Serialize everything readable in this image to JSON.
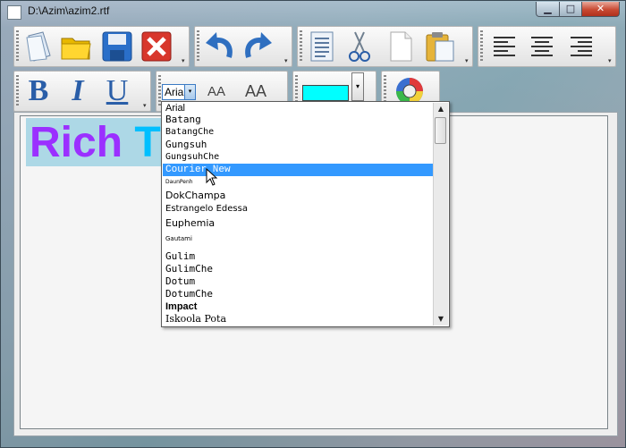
{
  "window": {
    "title": "D:\\Azim\\azim2.rtf",
    "minimize_glyph": "▁",
    "maximize_glyph": "□",
    "close_glyph": "✕"
  },
  "toolbar": {
    "file_icons": [
      "new-document-icon",
      "open-folder-icon",
      "save-icon",
      "close-icon"
    ],
    "undo_icons": [
      "undo-icon",
      "redo-icon"
    ],
    "edit_icons": [
      "select-all-icon",
      "cut-icon",
      "copy-icon",
      "paste-icon"
    ],
    "align_icons": [
      "align-left-icon",
      "align-center-icon",
      "align-right-icon"
    ],
    "bold_glyph": "B",
    "italic_glyph": "I",
    "underline_glyph": "U",
    "grow_font_label": "AA",
    "shrink_font_label": "AA",
    "overflow_glyph": "▾"
  },
  "font_combo": {
    "selected": "Arial",
    "arrow": "▾"
  },
  "color_picker": {
    "color": "#00ffff",
    "arrow": "▾"
  },
  "font_list": {
    "items": [
      "Arial",
      "Batang",
      "BatangChe",
      "Gungsuh",
      "GungsuhChe",
      "Courier New",
      "DaunPenh",
      "DokChampa",
      "Estrangelo Edessa",
      "Euphemia",
      "Gautami",
      "Gulim",
      "GulimChe",
      "Dotum",
      "DotumChe",
      "Impact",
      "Iskoola Pota"
    ],
    "selected_index": 5,
    "scroll_up": "▲",
    "scroll_down": "▼"
  },
  "document": {
    "text_part1": "Rich ",
    "text_part2": "T",
    "color1": "#9b30ff",
    "color2": "#00bfff",
    "highlight": "#add8e6"
  }
}
